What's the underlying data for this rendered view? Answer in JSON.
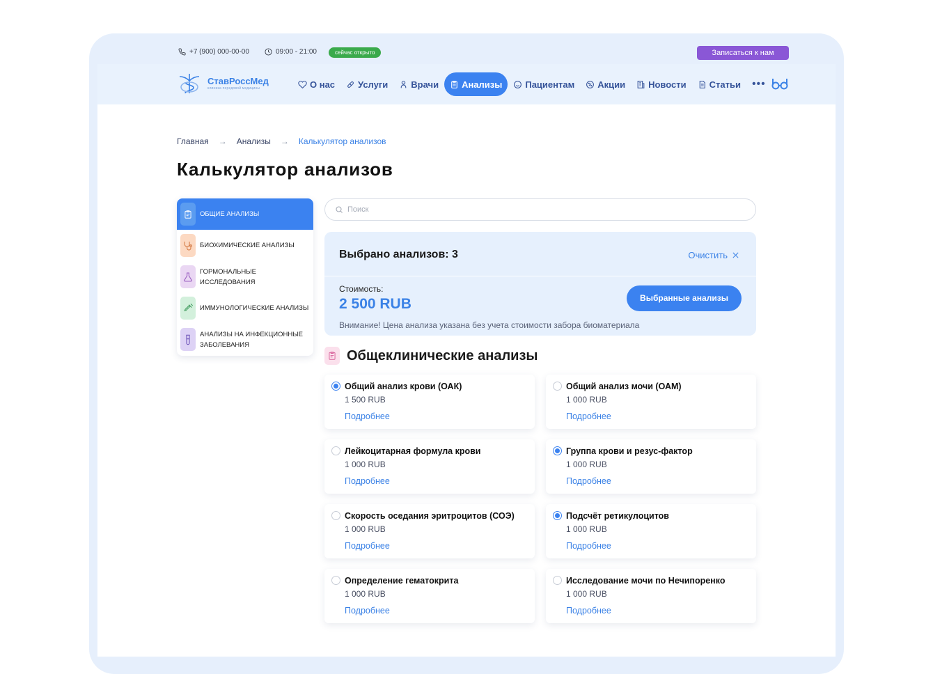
{
  "topbar": {
    "phone": "+7 (900) 000-00-00",
    "hours": "09:00 - 21:00",
    "open_status": "сейчас открыто",
    "book_button": "Записаться к нам"
  },
  "brand": {
    "name": "СтавРоссМед",
    "tagline": "клиника передовой медицины"
  },
  "nav": {
    "items": [
      {
        "label": "О нас",
        "icon": "heart-icon"
      },
      {
        "label": "Услуги",
        "icon": "pills-icon"
      },
      {
        "label": "Врачи",
        "icon": "doctor-icon"
      },
      {
        "label": "Анализы",
        "icon": "clipboard-icon"
      },
      {
        "label": "Пациентам",
        "icon": "smile-icon"
      },
      {
        "label": "Акции",
        "icon": "percent-icon"
      },
      {
        "label": "Новости",
        "icon": "building-icon"
      },
      {
        "label": "Статьи",
        "icon": "document-icon"
      }
    ],
    "active_index": 3,
    "more_label": "•••"
  },
  "breadcrumb": {
    "items": [
      "Главная",
      "Анализы",
      "Калькулятор анализов"
    ],
    "separator": "→"
  },
  "page": {
    "title": "Калькулятор анализов"
  },
  "categories": [
    {
      "label": "Общие анализы",
      "color": "#5b9cf0",
      "active": true
    },
    {
      "label": "Биохимические анализы",
      "color": "#fcd9c2",
      "active": false
    },
    {
      "label": "Гормональные исследования",
      "color": "#ead7f3",
      "active": false
    },
    {
      "label": "Иммунологические анализы",
      "color": "#d3f0dc",
      "active": false
    },
    {
      "label": "Анализы на инфекционные заболевания",
      "color": "#ddd2f5",
      "active": false
    }
  ],
  "search": {
    "placeholder": "Поиск"
  },
  "summary": {
    "selected_count": "Выбрано анализов: 3",
    "clear_label": "Очистить",
    "cost_label": "Стоимость:",
    "cost_value": "2 500 RUB",
    "selected_button": "Выбранные анализы",
    "note": "Внимание! Цена анализа указана без учета стоимости забора биоматериала"
  },
  "section": {
    "title": "Общеклинические анализы"
  },
  "analyses": [
    {
      "name": "Общий анализ крови (ОАК)",
      "price": "1 500 RUB",
      "more": "Подробнее",
      "selected": true
    },
    {
      "name": "Общий анализ мочи (ОАМ)",
      "price": "1 000 RUB",
      "more": "Подробнее",
      "selected": false
    },
    {
      "name": "Лейкоцитарная формула крови",
      "price": "1 000 RUB",
      "more": "Подробнее",
      "selected": false
    },
    {
      "name": "Группа крови и резус-фактор",
      "price": "1 000 RUB",
      "more": "Подробнее",
      "selected": true
    },
    {
      "name": "Скорость оседания эритроцитов (СОЭ)",
      "price": "1 000 RUB",
      "more": "Подробнее",
      "selected": false
    },
    {
      "name": "Подсчёт ретикулоцитов",
      "price": "1 000 RUB",
      "more": "Подробнее",
      "selected": true
    },
    {
      "name": "Определение гематокрита",
      "price": "1 000 RUB",
      "more": "Подробнее",
      "selected": false
    },
    {
      "name": "Исследование мочи по Нечипоренко",
      "price": "1 000 RUB",
      "more": "Подробнее",
      "selected": false
    }
  ],
  "colors": {
    "accent": "#3b82f0",
    "book_button": "#8a57d6",
    "open_badge": "#3aaa4b",
    "frame": "#e6effc"
  }
}
